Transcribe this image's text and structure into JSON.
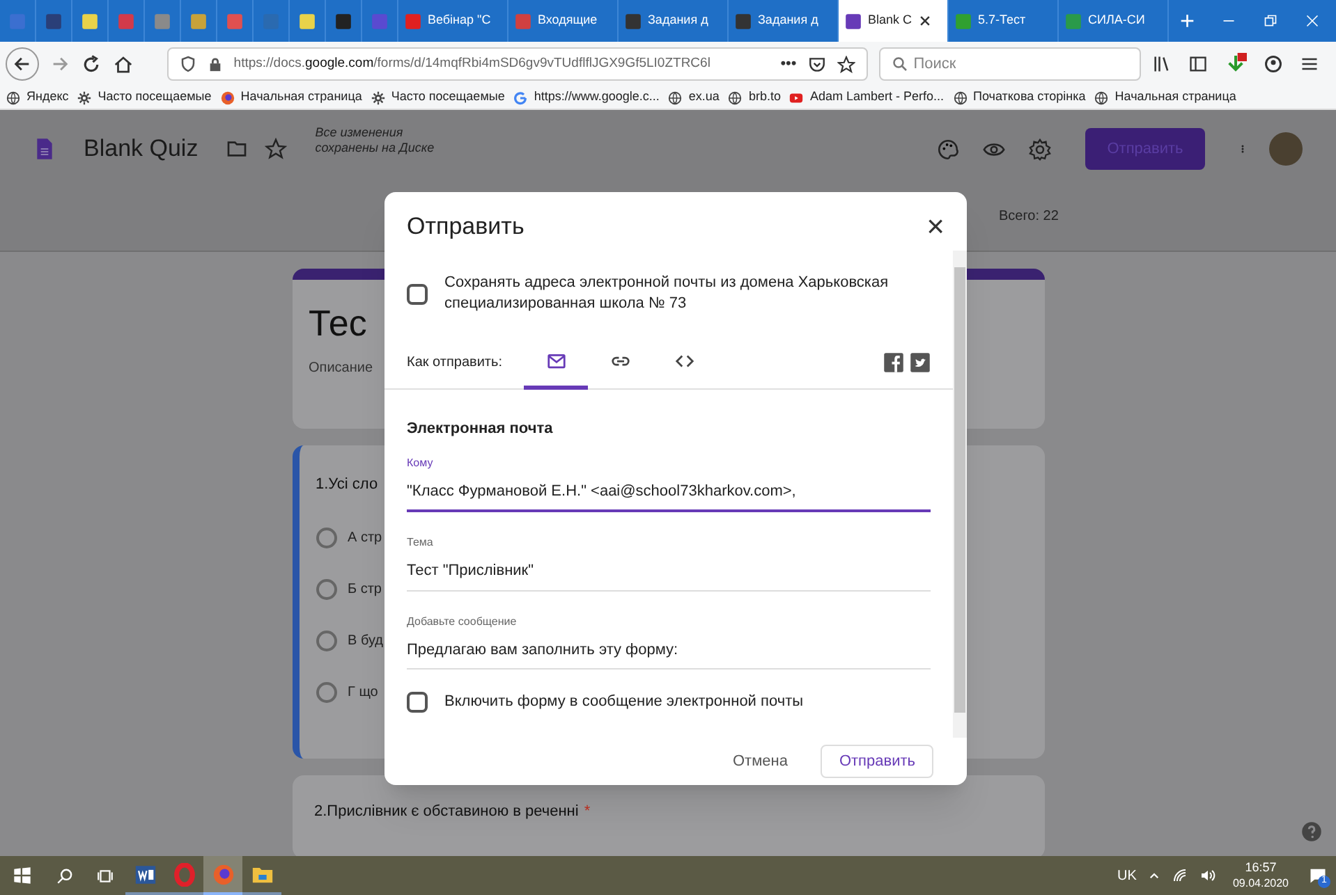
{
  "browser_tabs": [
    {
      "kind": "icon",
      "color": "#3b6fd0",
      "selected": false
    },
    {
      "kind": "icon",
      "color": "#2a3f78",
      "selected": false
    },
    {
      "kind": "icon",
      "color": "#e8d24a",
      "selected": false
    },
    {
      "kind": "icon",
      "color": "#d23a4a",
      "selected": false
    },
    {
      "kind": "icon",
      "color": "#8a8a8a",
      "selected": false
    },
    {
      "kind": "icon",
      "color": "#c8a23a",
      "selected": false
    },
    {
      "kind": "icon",
      "color": "#e05050",
      "selected": false
    },
    {
      "kind": "icon",
      "color": "#2a6ab0",
      "selected": false
    },
    {
      "kind": "icon",
      "color": "#e8d24a",
      "selected": false
    },
    {
      "kind": "icon",
      "color": "#222222",
      "selected": false
    },
    {
      "kind": "icon",
      "color": "#5a4ad0",
      "selected": false
    },
    {
      "kind": "text",
      "color": "#e02020",
      "label": "Вебінар \"С",
      "selected": false
    },
    {
      "kind": "text",
      "color": "#d04040",
      "label": "Входящие",
      "selected": false
    },
    {
      "kind": "text",
      "color": "#333333",
      "label": "Задания д",
      "selected": false
    },
    {
      "kind": "text",
      "color": "#333333",
      "label": "Задания д",
      "selected": false
    },
    {
      "kind": "text",
      "color": "#673ab7",
      "label": "Blank C",
      "selected": true
    },
    {
      "kind": "text",
      "color": "#30a030",
      "label": "5.7-Тест",
      "selected": false
    },
    {
      "kind": "text",
      "color": "#2a9a4a",
      "label": "СИЛА-СИ",
      "selected": false
    }
  ],
  "new_tab": "+",
  "address": {
    "prefix": "https://docs.",
    "domain": "google.com",
    "path": "/forms/d/14mqfRbi4mSD6gv9vTUdflflJGX9Gf5LI0ZTRC6l",
    "more": "•••"
  },
  "search": {
    "placeholder": "Поиск"
  },
  "bookmarks": [
    {
      "kind": "globe",
      "label": "Яндекс"
    },
    {
      "kind": "gear",
      "label": "Часто посещаемые"
    },
    {
      "kind": "firefox",
      "label": "Начальная страница"
    },
    {
      "kind": "gear",
      "label": "Часто посещаемые"
    },
    {
      "kind": "google",
      "label": "https://www.google.c..."
    },
    {
      "kind": "globe",
      "label": "ex.ua"
    },
    {
      "kind": "globe",
      "label": "brb.to"
    },
    {
      "kind": "youtube",
      "label": "Adam Lambert - Perfo..."
    },
    {
      "kind": "globe",
      "label": "Початкова сторінка"
    },
    {
      "kind": "globe",
      "label": "Начальная страница"
    }
  ],
  "form_header": {
    "title": "Blank Quiz",
    "save_status": "Все изменения сохранены на Диске",
    "send_button": "Отправить",
    "total": "Всего: 22"
  },
  "form": {
    "title": "Тес",
    "description": "Описание",
    "question_1": {
      "text": "1.Усі сло",
      "options": [
        {
          "label": "А стр",
          "selected": false
        },
        {
          "label": "Б стр",
          "selected": false
        },
        {
          "label": "В буд",
          "selected": false
        },
        {
          "label": "Г що",
          "selected": false
        }
      ]
    },
    "question_2": {
      "text": "2.Прислівник є обставиною в реченні",
      "required_mark": "*"
    }
  },
  "dialog": {
    "title": "Отправить",
    "close": "×",
    "save_emails": {
      "label": "Сохранять адреса электронной почты из домена Харьковская специализированная школа № 73",
      "checked": false
    },
    "send_via_label": "Как отправить:",
    "send_methods": [
      {
        "kind": "email",
        "selected": true
      },
      {
        "kind": "link",
        "selected": false
      },
      {
        "kind": "embed",
        "selected": false
      }
    ],
    "section": "Электронная почта",
    "fields": [
      {
        "label": "Кому",
        "value": "\"Класс Фурмановой Е.Н.\" <aai@school73kharkov.com>,",
        "focused": true
      },
      {
        "label": "Тема",
        "value": "Тест \"Прислівник\"",
        "focused": false
      },
      {
        "label": "Добавьте сообщение",
        "value": "Предлагаю вам заполнить эту форму:",
        "focused": false
      }
    ],
    "include_form": {
      "label": "Включить форму в сообщение электронной почты",
      "checked": false
    },
    "buttons": [
      "Отмена",
      "Отправить"
    ]
  },
  "taskbar": {
    "apps": [
      {
        "kind": "word",
        "selected": false
      },
      {
        "kind": "opera",
        "selected": false
      },
      {
        "kind": "firefox",
        "selected": true
      },
      {
        "kind": "explorer",
        "selected": false
      }
    ],
    "language": "UK",
    "time": "16:57",
    "date": "09.04.2020",
    "notifications": "1"
  }
}
